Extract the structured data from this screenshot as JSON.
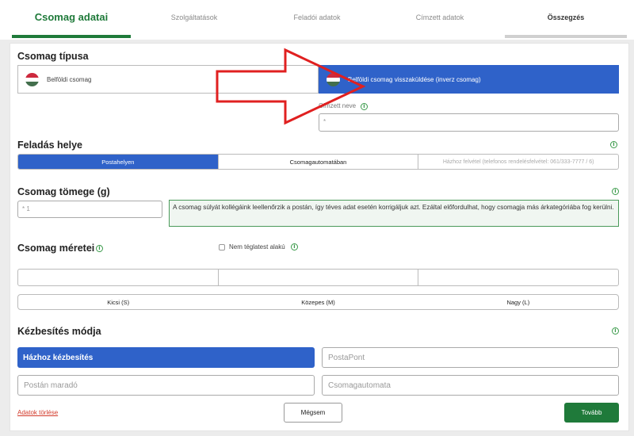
{
  "tabs": [
    {
      "label": "Csomag adatai"
    },
    {
      "label": "Szolgáltatások"
    },
    {
      "label": "Feladói adatok"
    },
    {
      "label": "Címzett adatok"
    },
    {
      "label": "Összegzés"
    }
  ],
  "package_type": {
    "title": "Csomag típusa",
    "options": [
      {
        "label": "Belföldi csomag"
      },
      {
        "label": "Belföldi csomag visszaküldése (inverz csomag)"
      }
    ],
    "recipient_label": "Címzett neve",
    "recipient_placeholder": "*"
  },
  "posting_place": {
    "title": "Feladás helye",
    "options": [
      {
        "label": "Postahelyen"
      },
      {
        "label": "Csomagautomatában"
      },
      {
        "label": "Házhoz felvétel (telefonos rendelésfelvétel: 061/333-7777 / 6)"
      }
    ]
  },
  "weight": {
    "title": "Csomag tömege (g)",
    "placeholder": "* 1",
    "note": "A csomag súlyát kollégáink leellenőrzik a postán, így téves adat esetén korrigáljuk azt. Ezáltal előfordulhat, hogy csomagja más árkategóriába fog kerülni."
  },
  "dimensions": {
    "title": "Csomag méretei",
    "non_rect_label": "Nem téglatest alakú",
    "sizes": [
      {
        "label": "Kicsi (S)"
      },
      {
        "label": "Közepes (M)"
      },
      {
        "label": "Nagy (L)"
      }
    ]
  },
  "delivery": {
    "title": "Kézbesítés módja",
    "options": [
      {
        "label": "Házhoz kézbesítés"
      },
      {
        "label": "PostaPont"
      },
      {
        "label": "Postán maradó"
      },
      {
        "label": "Csomagautomata"
      }
    ]
  },
  "footer": {
    "clear_link": "Adatok törlése",
    "cancel_label": "Mégsem",
    "next_label": "Tovább"
  },
  "colors": {
    "brand_green": "#1f7a3a",
    "primary_blue": "#2f62c9",
    "annotation_arrow": "#e02020"
  },
  "icons": {
    "info": "info-circle-icon",
    "flag": "hungary-flag-icon"
  }
}
